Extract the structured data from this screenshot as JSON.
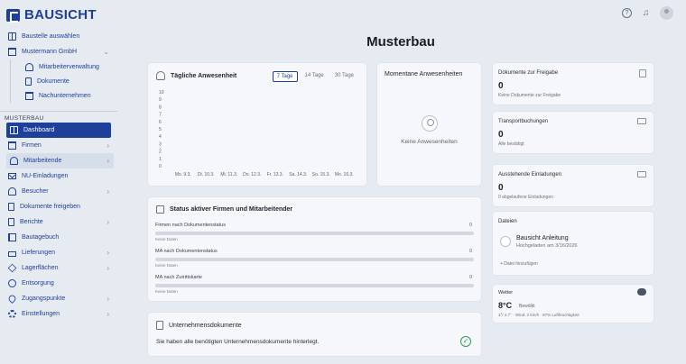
{
  "app": {
    "logo_text": "BAUSICHT"
  },
  "header": {
    "help_icon": "question-icon",
    "bell_icon": "bell-icon",
    "avatar_icon": "user-avatar-icon"
  },
  "sidebar": {
    "select_site": "Baustelle auswählen",
    "company": "Mustermann GmbH",
    "company_sub": [
      "Mitarbeiterverwaltung",
      "Dokumente",
      "Nachunternehmen"
    ],
    "section": "MUSTERBAU",
    "items": [
      {
        "label": "Dashboard",
        "icon": "grid-icon",
        "chevron": false
      },
      {
        "label": "Firmen",
        "icon": "building-icon",
        "chevron": true
      },
      {
        "label": "Mitarbeitende",
        "icon": "users-icon",
        "chevron": true
      },
      {
        "label": "NU-Einladungen",
        "icon": "mail-icon",
        "chevron": false
      },
      {
        "label": "Besucher",
        "icon": "visitor-icon",
        "chevron": true
      },
      {
        "label": "Dokumente freigeben",
        "icon": "document-icon",
        "chevron": false
      },
      {
        "label": "Berichte",
        "icon": "report-icon",
        "chevron": true
      },
      {
        "label": "Bautagebuch",
        "icon": "book-icon",
        "chevron": false
      },
      {
        "label": "Lieferungen",
        "icon": "truck-icon",
        "chevron": true
      },
      {
        "label": "Lagerflächen",
        "icon": "layers-icon",
        "chevron": true
      },
      {
        "label": "Entsorgung",
        "icon": "recycle-icon",
        "chevron": false
      },
      {
        "label": "Zugangspunkte",
        "icon": "pin-icon",
        "chevron": true
      },
      {
        "label": "Einstellungen",
        "icon": "gear-icon",
        "chevron": true
      }
    ]
  },
  "main": {
    "title": "Musterbau",
    "attendance": {
      "title": "Tägliche Anwesenheit",
      "ranges": [
        "7 Tage",
        "14 Tage",
        "30 Tage"
      ],
      "selected_range": "7 Tage"
    },
    "current": {
      "title": "Momentane Anwesenheiten",
      "empty": "Keine Anwesenheiten"
    },
    "status": {
      "title": "Status aktiver Firmen und Mitarbeitender",
      "rows": [
        {
          "label": "Firmen nach Dokumentenstatus",
          "count": "0",
          "sub": "Keine Daten"
        },
        {
          "label": "MA nach Dokumentenstatus",
          "count": "0",
          "sub": "Keine Daten"
        },
        {
          "label": "MA nach Zutrittskarte",
          "count": "0",
          "sub": "Keine Daten"
        }
      ]
    },
    "company_docs": {
      "title": "Unternehmensdokumente",
      "message": "Sie haben alle benötigten Unternehmensdokumente hinterlegt."
    }
  },
  "right": {
    "release": {
      "title": "Dokumente zur Freigabe",
      "value": "0",
      "sub": "Keine Dokumente zur Freigabe"
    },
    "transport": {
      "title": "Transportbuchungen",
      "value": "0",
      "sub": "Alle bestätigt"
    },
    "invites": {
      "title": "Ausstehende Einladungen",
      "value": "0",
      "sub": "0 abgelaufene Einladungen"
    },
    "files": {
      "title": "Dateien",
      "file_name": "Bausicht Anleitung",
      "file_date": "Hochgeladen am 3/16/2026",
      "add": "+ Datei hinzufügen"
    },
    "weather": {
      "title": "Wetter",
      "temp": "8°C",
      "cond": "Bewölkt",
      "details": "1°/ 4.7° · Wind: 2 km/h · 87% Luftfeuchtigkeit"
    }
  },
  "chart_data": {
    "type": "line",
    "title": "Tägliche Anwesenheit",
    "categories": [
      "Mo. 9.3.",
      "Di. 10.3.",
      "Mi. 11.3.",
      "Do. 12.3.",
      "Fr. 13.3.",
      "Sa. 14.3.",
      "So. 15.3.",
      "Mo. 16.3."
    ],
    "series": [
      {
        "values": [
          0,
          0,
          0,
          0,
          0,
          0,
          0,
          0
        ]
      }
    ],
    "ylim": [
      0,
      10
    ],
    "yticks": [
      0,
      1,
      2,
      3,
      4,
      5,
      6,
      7,
      8,
      9,
      10
    ],
    "grid": false
  }
}
